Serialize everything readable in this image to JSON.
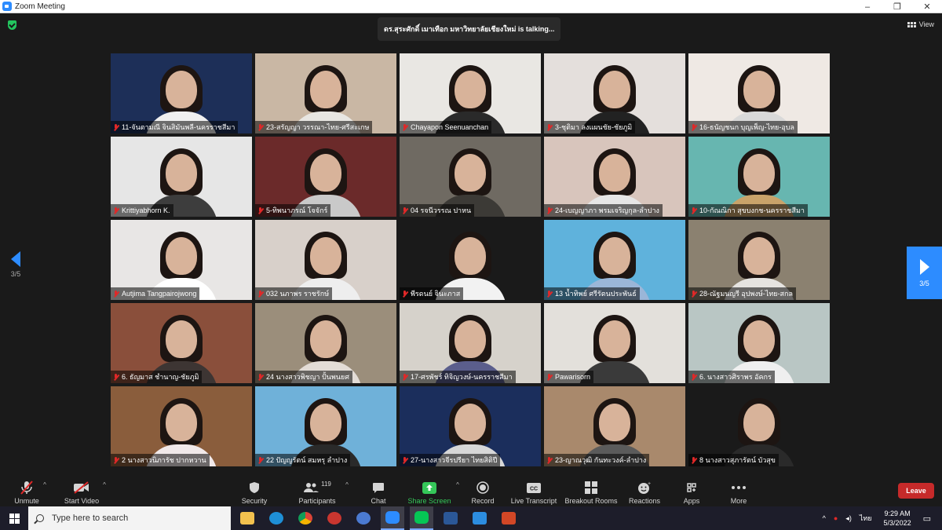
{
  "window": {
    "title": "Zoom Meeting",
    "controls": [
      "–",
      "❐",
      "✕"
    ]
  },
  "meeting": {
    "talking_banner": "ดร.สุระศักดิ์ เมาเทือก มหาวิทยาลัยเชียงใหม่ is  talking...",
    "view_label": "View",
    "page_prev": "3/5",
    "page_next": "3/5",
    "participants": [
      {
        "name": "11-จันตามณี จินสิมันพลี-นครราชสีมา",
        "bg": "#1d2f58",
        "shirt": "#f0f0f0"
      },
      {
        "name": "23-สรัญญา วรรณา-ไทย-ศรีสะเกษ",
        "bg": "#c9b7a4",
        "shirt": "#e8e6e2"
      },
      {
        "name": "Chayapon Seenuanchan",
        "bg": "#e9e7e3",
        "shirt": "#2a2a2a"
      },
      {
        "name": "3-ชุติมา ลงแผนชัย-ชัยภูมิ",
        "bg": "#e4dfdc",
        "shirt": "#222222"
      },
      {
        "name": "16-ธนัญชนก บุญเพ็ญ-ไทย-อุบล",
        "bg": "#efe9e4",
        "shirt": "#d9d9d9"
      },
      {
        "name": "Krittiyabhorn K.",
        "bg": "#e6e6e6",
        "shirt": "#3d3d3d"
      },
      {
        "name": "5-ทิพนาภรณ์ โจจักร์",
        "bg": "#6b2a2a",
        "shirt": "#c9c9c9"
      },
      {
        "name": "04 รจนีวรรณ ปาหน",
        "bg": "#6f6a62",
        "shirt": "#3c3a36"
      },
      {
        "name": "24-เบญญาภา พรมเจริญกุล-ลำปาง",
        "bg": "#d8c5bc",
        "shirt": "#e6e6e6"
      },
      {
        "name": "10-กัณณิกา สุขบงกช-นครราชสีมา",
        "bg": "#67b6b0",
        "shirt": "#c9a36a"
      },
      {
        "name": "Autjima Tangpairojwong",
        "bg": "#e8e6e5",
        "shirt": "#ffffff"
      },
      {
        "name": "032 นภาพร ราชรักษ์",
        "bg": "#d8d0ca",
        "shirt": "#eeeeee"
      },
      {
        "name": "พีรดนย์ จินะภาส",
        "bg": "#1a1a1a",
        "shirt": "#f2f2f2"
      },
      {
        "name": "13 น้ำทิพย์ ศรีรัตนประพันธ์",
        "bg": "#5fb2dc",
        "shirt": "#9bb6d8"
      },
      {
        "name": "28-ณัฐมนญรี อุปพงษ์-ไทย-สกล",
        "bg": "#8b8170",
        "shirt": "#e5e3e0"
      },
      {
        "name": "6. ธัญมาส ชำนาญ-ชัยภูมิ",
        "bg": "#8a4f3b",
        "shirt": "#3d3533"
      },
      {
        "name": "24 นางสาวพิชญา ปั้นพนยศ",
        "bg": "#9b8e7b",
        "shirt": "#e3dcd6"
      },
      {
        "name": "17-ศรพัชร์ ทิจิญวงษ์-นครราชสีมา",
        "bg": "#d6d2cb",
        "shirt": "#5b5e8c"
      },
      {
        "name": "Pawarisorn",
        "bg": "#e3e0db",
        "shirt": "#3a3a3a"
      },
      {
        "name": "6. นางสาวศิราพร อัคกร",
        "bg": "#b9c6c4",
        "shirt": "#efefef"
      },
      {
        "name": "2 นางสาวนิภารัช ปากหวาน",
        "bg": "#8a5d3c",
        "shirt": "#f1e9ea"
      },
      {
        "name": "22 ปัญญรัตน์ สมหรุ ลำปาง",
        "bg": "#6fb1d9",
        "shirt": "#2a2a2a"
      },
      {
        "name": "27-นางสาวจีรปรียา ไทยสิติปี",
        "bg": "#1b2e5c",
        "shirt": "#d7d7d7"
      },
      {
        "name": "23-ญาณวุฒิ กันทะวงค์-ลำปาง",
        "bg": "#a9896c",
        "shirt": "#5b5b5b"
      },
      {
        "name": "8 นางสาวสุภารัตน์ บัวสุข",
        "bg": "#1a1a1a",
        "shirt": "#2a2a2a"
      }
    ]
  },
  "toolbar": {
    "unmute": "Unmute",
    "start_video": "Start Video",
    "security": "Security",
    "participants": "Participants",
    "participants_count": "119",
    "chat": "Chat",
    "share_screen": "Share Screen",
    "record": "Record",
    "live_transcript": "Live Transcript",
    "breakout_rooms": "Breakout Rooms",
    "reactions": "Reactions",
    "apps": "Apps",
    "more": "More",
    "leave": "Leave"
  },
  "taskbar": {
    "search_placeholder": "Type here to search",
    "time": "9:29 AM",
    "date": "5/3/2022",
    "lang": "ไทย"
  },
  "colors": {
    "accent": "#2d8cff",
    "share_green": "#35c759",
    "leave_red": "#c62a2a",
    "muted_red": "#e02828"
  }
}
